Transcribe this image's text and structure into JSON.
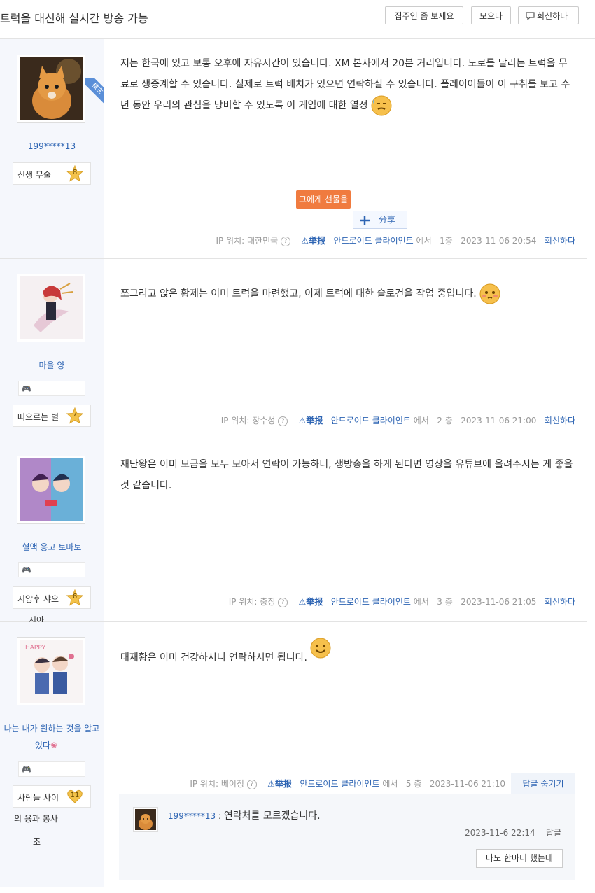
{
  "header": {
    "title": "트럭을 대신해 실시간 방송 가능",
    "buttons": [
      "집주인 좀 보세요",
      "모으다",
      "회신하다"
    ]
  },
  "posts": [
    {
      "username": "199*****13",
      "rank_name": "신생 무술",
      "rank_level": "8",
      "badge": "",
      "author_tag": "楼主",
      "content": "저는 한국에 있고 보통 오후에 자유시간이 있습니다. XM 본사에서 20분 거리입니다. 도로를 달리는 트럭을 무료로 생중계할 수 있습니다. 실제로 트럭 배치가 있으면 연락하실 수 있습니다. 플레이어들이 이 구취를 보고 수년 동안 우리의 관심을 낭비할 수 있도록 이 게임에 대한 열정",
      "gift_label": "그에게 선물을",
      "share_label": "分享",
      "ip": "IP 위치: 대한민국",
      "report": "举报",
      "client": "안드로이드 클라이언트",
      "via": "에서",
      "floor": "1층",
      "time": "2023-11-06 20:54",
      "reply": "회신하다"
    },
    {
      "username": "마을 양",
      "rank_name": "떠오르는 별",
      "rank_level": "7",
      "content": "쪼그리고 앉은 황제는 이미 트럭을 마련했고, 이제 트럭에 대한 슬로건을 작업 중입니다.",
      "ip": "IP 위치: 장수성",
      "report": "举报",
      "client": "안드로이드 클라이언트",
      "via": "에서",
      "floor": "2 층",
      "time": "2023-11-06 21:00",
      "reply": "회신하다"
    },
    {
      "username": "혈액 응고 토마토",
      "rank_name": "지앙후 샤오",
      "rank_name_2": "시아",
      "rank_level": "6",
      "content": "재난왕은 이미 모금을 모두 모아서 연락이 가능하니, 생방송을 하게 된다면 영상을 유튜브에 올려주시는 게 좋을 것 같습니다.",
      "ip": "IP 위치: 충칭",
      "report": "举报",
      "client": "안드로이드 클라이언트",
      "via": "에서",
      "floor": "3 층",
      "time": "2023-11-06 21:05",
      "reply": "회신하다"
    },
    {
      "username": "나는 내가 원하는 것을 알고",
      "username_2": "있다",
      "rank_name": "사람들 사이",
      "rank_name_2": "의 용과 봉사",
      "rank_name_3": "조",
      "rank_level": "11",
      "content": "대재황은 이미 건강하시니 연락하시면 됩니다.",
      "ip": "IP 위치: 베이징",
      "report": "举报",
      "client": "안드로이드 클라이언트",
      "via": "에서",
      "floor": "5 층",
      "time": "2023-11-06 21:10",
      "hide_replies": "답글 숨기기",
      "sub_reply": {
        "username": "199*****13",
        "separator": ":",
        "text": "연락처를 모르겠습니다.",
        "time": "2023-11-6 22:14",
        "reply": "답글"
      },
      "say_something": "나도 한마디 했는데"
    }
  ],
  "colors": {
    "link": "#2d64b3",
    "gift": "#f07b3f",
    "sidebar_bg": "#f5f7fc",
    "star": "#f3c24a"
  }
}
